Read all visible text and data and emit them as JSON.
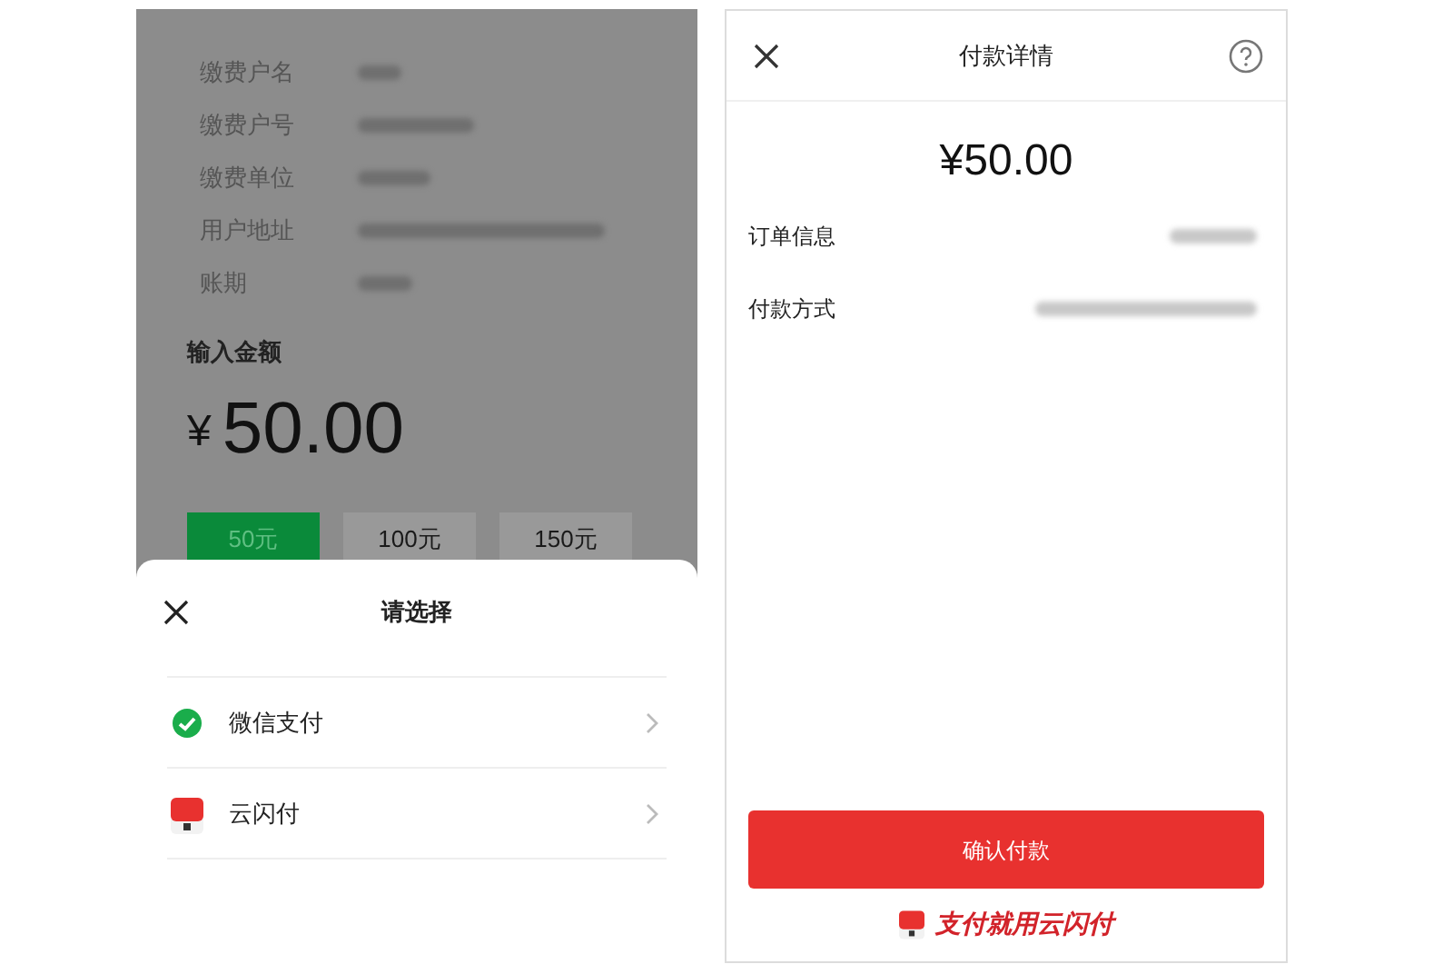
{
  "payment_page": {
    "info_rows": [
      {
        "label": "缴费户名"
      },
      {
        "label": "缴费户号"
      },
      {
        "label": "缴费单位"
      },
      {
        "label": "用户地址"
      },
      {
        "label": "账期"
      }
    ],
    "amount_label": "输入金额",
    "currency": "¥",
    "amount": "50.00",
    "amount_options": [
      {
        "label": "50元",
        "selected": true
      },
      {
        "label": "100元",
        "selected": false
      },
      {
        "label": "150元",
        "selected": false
      }
    ]
  },
  "select_sheet": {
    "title": "请选择",
    "methods": [
      {
        "label": "微信支付",
        "kind": "wechat"
      },
      {
        "label": "云闪付",
        "kind": "unionpay"
      }
    ]
  },
  "detail_page": {
    "title": "付款详情",
    "amount": "¥50.00",
    "rows": [
      {
        "label": "订单信息"
      },
      {
        "label": "付款方式"
      }
    ],
    "confirm_button": "确认付款",
    "footer_slogan": "支付就用云闪付"
  }
}
